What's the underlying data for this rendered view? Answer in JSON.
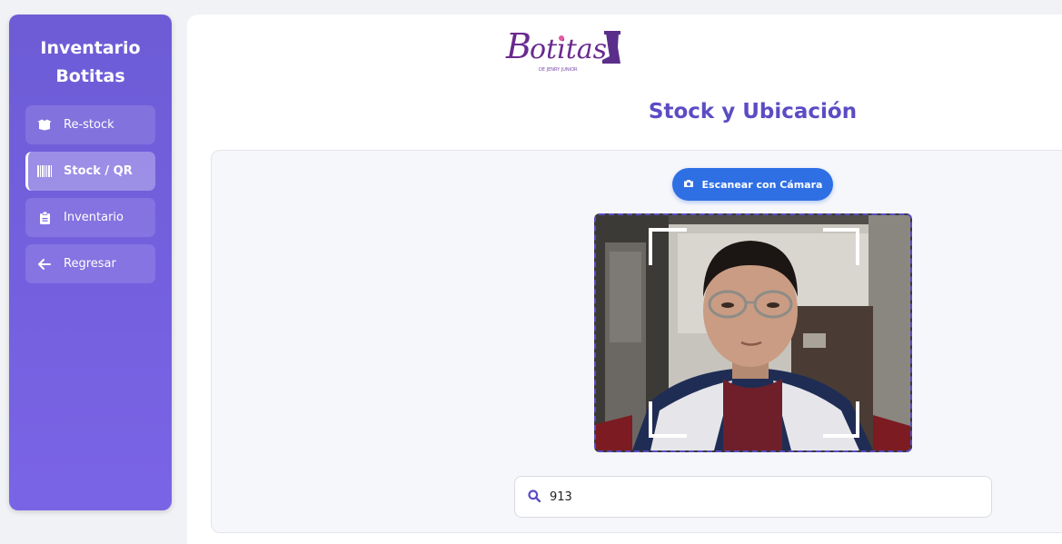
{
  "sidebar": {
    "brand_line1": "Inventario",
    "brand_line2": "Botitas",
    "items": [
      {
        "label": "Re-stock",
        "icon": "box-open-icon",
        "active": false
      },
      {
        "label": "Stock / QR",
        "icon": "barcode-icon",
        "active": true
      },
      {
        "label": "Inventario",
        "icon": "clipboard-icon",
        "active": false
      },
      {
        "label": "Regresar",
        "icon": "arrow-left-icon",
        "active": false
      }
    ]
  },
  "header": {
    "logo_text": "Botitas",
    "logo_subtext": "DE JENRY JUNIOR",
    "title": "Stock y Ubicación"
  },
  "scanner": {
    "button_label": "Escanear con Cámara",
    "button_icon": "camera-icon"
  },
  "search": {
    "value": "913",
    "icon": "search-icon"
  },
  "colors": {
    "sidebar": "#7a64e6",
    "accent": "#5b4cc4",
    "button": "#2f6fe4",
    "background": "#f1f2f5"
  }
}
